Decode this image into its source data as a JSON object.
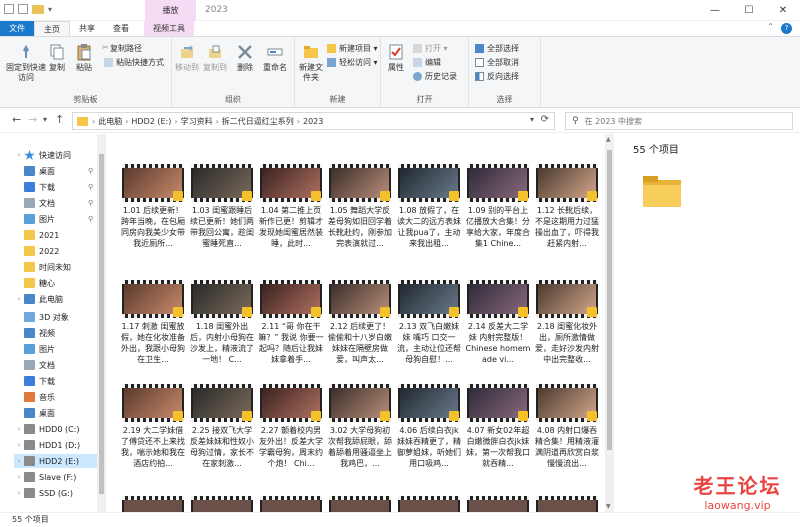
{
  "window": {
    "title": "2023",
    "context_tab": "播放",
    "controls": [
      "—",
      "☐",
      "✕"
    ]
  },
  "tabs": [
    {
      "label": "文件",
      "kind": "file"
    },
    {
      "label": "主页",
      "kind": "active"
    },
    {
      "label": "共享",
      "kind": "normal"
    },
    {
      "label": "查看",
      "kind": "normal"
    },
    {
      "label": "视频工具",
      "kind": "ctx"
    }
  ],
  "ribbon": {
    "clipboard": {
      "label": "剪贴板",
      "pin": "固定到快速访问",
      "copy": "复制",
      "paste": "粘贴",
      "copy_path": "复制路径",
      "paste_shortcut": "粘贴快捷方式",
      "cut": "✂"
    },
    "organize": {
      "label": "组织",
      "move_to": "移动到",
      "copy_to": "复制到",
      "delete": "删除",
      "rename": "重命名"
    },
    "new": {
      "label": "新建",
      "new_folder": "新建文件夹",
      "new_item": "新建项目 ▾",
      "easy_access": "轻松访问 ▾"
    },
    "open": {
      "label": "打开",
      "properties": "属性",
      "open": "打开 ▾",
      "edit": "编辑",
      "history": "历史记录"
    },
    "select": {
      "label": "选择",
      "select_all": "全部选择",
      "select_none": "全部取消",
      "invert": "反向选择"
    }
  },
  "nav": {
    "back": "←",
    "forward": "→",
    "dropdown": "▾",
    "up": "↑",
    "crumbs": [
      "此电脑",
      "HDD2 (E:)",
      "学习资料",
      "拆二代日逼红尘系列",
      "2023"
    ],
    "search_placeholder": "在 2023 中搜索"
  },
  "sidebar": {
    "quick_access": "快速访问",
    "quick_items": [
      {
        "label": "桌面",
        "pinned": true
      },
      {
        "label": "下载",
        "pinned": true
      },
      {
        "label": "文档",
        "pinned": true
      },
      {
        "label": "图片",
        "pinned": true
      },
      {
        "label": "2021",
        "pinned": false
      },
      {
        "label": "2022",
        "pinned": false
      },
      {
        "label": "时间未知",
        "pinned": false
      },
      {
        "label": "糖心",
        "pinned": false
      }
    ],
    "this_pc": "此电脑",
    "pc_items": [
      "3D 对象",
      "视频",
      "图片",
      "文档",
      "下载",
      "音乐",
      "桌面",
      "HDD0 (C:)",
      "HDD1 (D:)",
      "HDD2 (E:)",
      "Slave (F:)",
      "SSD (G:)"
    ],
    "selected": "HDD2 (E:)"
  },
  "files": [
    {
      "caption": "1.01 后续更新！跨年当晚，在包厢同房向我美少女带我近厕所..."
    },
    {
      "caption": "1.03 闺蜜跟睡后续已更新！她们两带我回公寓，趁闺蜜睡死直..."
    },
    {
      "caption": "1.04 第二推上页新作已更！剪辑才发现她闺蜜居然装睡，此时..."
    },
    {
      "caption": "1.05 舞蹈大学反差母狗如旧回学着长靴赴约，刚参加完表演就过..."
    },
    {
      "caption": "1.08 放假了，在读大二的远方表妹让我pua了，主动来我出租..."
    },
    {
      "caption": "1.09 别的平台上亿播放大合集！分享给大家，年度合集1 Chine..."
    },
    {
      "caption": "1.12 长靴后续，不是这期用力过猛操出血了，吓得我赶紧内射..."
    },
    {
      "caption": "1.17 刺激 闺蜜放假，她在化妆准备外出，我跟小母狗在卫生..."
    },
    {
      "caption": "1.18 闺蜜外出后，内射小母狗在沙发上，精液流了一地！ C..."
    },
    {
      "caption": "2.11 “哥 你在干嘛？” 我说 你要一起吗？随后让我妹妹拿着手..."
    },
    {
      "caption": "2.12 后续更了！偷偷和十八岁白嫩妹妹在隔壁房做爱，叫声太..."
    },
    {
      "caption": "2.13 双飞白嫩妹妹 嘴巧 口交一流，主动让位还帮母狗自慰！..."
    },
    {
      "caption": "2.14 反差大二学妹 内射完整版！ Chinese homemade vi..."
    },
    {
      "caption": "2.18 闺蜜化妆外出，厕所激情做爱，走好沙发内射中出完整收..."
    },
    {
      "caption": "2.19 大二学妹借了傅贷还不上来找我，喘示她和我在酒店约拍..."
    },
    {
      "caption": "2.25 接双飞大学反差妹妹和性奴小母狗过情，家长不在家刺激..."
    },
    {
      "caption": "2.27 颤着校内男友外出！反差大学学霸母狗，周末约个炮！ Chi..."
    },
    {
      "caption": "3.02 大学母狗初次帮我舔屁眼，舔着舔着用骚逼坐上我鸡巴，..."
    },
    {
      "caption": "4.06 后续白衣jk妹妹吞精更了，精御萝姐妹，听她们用口吸鸡..."
    },
    {
      "caption": "4.07 新女02年超白嫩微胖白衣jk妹妹，第一次帮我口就吞精..."
    },
    {
      "caption": "4.08 内射口爆吞精合集！用精液灌满阴道再欣赏白浆慢慢流出..."
    }
  ],
  "preview": {
    "item_count": "55 个项目"
  },
  "status": {
    "text": "55 个项目"
  },
  "watermark": {
    "line1": "老王论坛",
    "line2": "laowang.vip"
  },
  "colors": {
    "accent": "#1979ca",
    "selection": "#cce8ff",
    "folder": "#f4c64a",
    "context": "#f5dbf3"
  }
}
